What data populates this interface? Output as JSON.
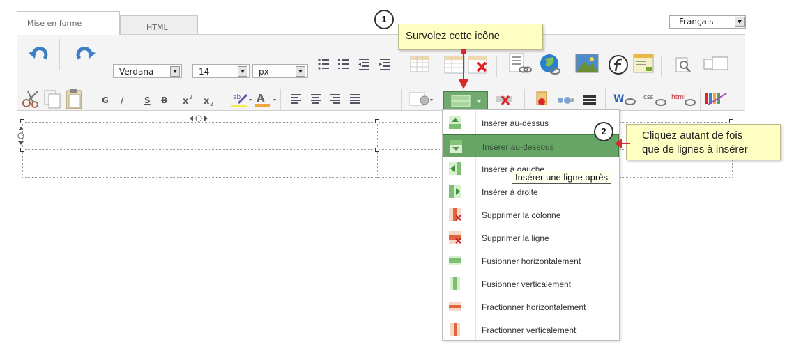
{
  "tabs": [
    {
      "label": "Mise en forme"
    },
    {
      "label": "HTML"
    }
  ],
  "language": {
    "selected": "Français"
  },
  "font": {
    "family": "Verdana",
    "size": "14",
    "unit": "px"
  },
  "toolbar_buttons": {
    "bold": "G",
    "italic": "/",
    "underline": "S",
    "strike": "B"
  },
  "menu": {
    "items": [
      {
        "label": "Insérer au-dessus",
        "icon": "insert-row-above-icon"
      },
      {
        "label": "Insérer au-dessous",
        "icon": "insert-row-below-icon"
      },
      {
        "label": "Insérer à gauche",
        "icon": "insert-col-left-icon"
      },
      {
        "label": "Insérer à droite",
        "icon": "insert-col-right-icon"
      },
      {
        "label": "Supprimer la colonne",
        "icon": "delete-col-icon"
      },
      {
        "label": "Supprimer la ligne",
        "icon": "delete-row-icon"
      },
      {
        "label": "Fusionner horizontalement",
        "icon": "merge-horizontal-icon"
      },
      {
        "label": "Fusionner verticalement",
        "icon": "merge-vertical-icon"
      },
      {
        "label": "Fractionner horizontalement",
        "icon": "split-horizontal-icon"
      },
      {
        "label": "Fractionner verticalement",
        "icon": "split-vertical-icon"
      }
    ]
  },
  "tooltip": {
    "text": "Insérer une ligne après"
  },
  "callouts": [
    {
      "number": "1",
      "text": "Survolez cette icône"
    },
    {
      "number": "2",
      "text_line1": "Cliquez autant de fois",
      "text_line2": "que de lignes à insérer"
    }
  ],
  "colors": {
    "accent_red": "#d9262b",
    "highlight_green": "#5a9e5a",
    "callout_bg": "#ffffc4"
  }
}
